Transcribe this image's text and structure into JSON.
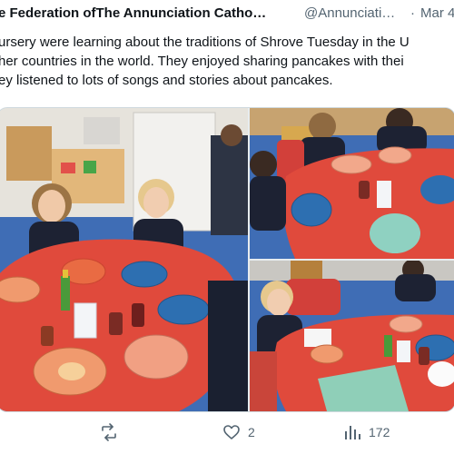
{
  "tweet": {
    "author_name": "e Federation ofThe Annunciation Catho…",
    "author_handle": "@Annunciati…",
    "separator": "·",
    "date": "Mar 4",
    "text_lines": [
      "ursery were learning about the traditions of Shrove Tuesday in the U",
      "her countries in the world. They enjoyed sharing pancakes with thei",
      "ey listened to lots of songs and stories about pancakes."
    ]
  },
  "actions": {
    "retweets": "",
    "likes": "2",
    "views": "172"
  },
  "icons": [
    "retweet-icon",
    "heart-icon",
    "views-icon"
  ],
  "colors": {
    "text": "#0f1419",
    "muted": "#536471",
    "table_red": "#e04a3c",
    "floor_blue": "#3f6db5"
  }
}
